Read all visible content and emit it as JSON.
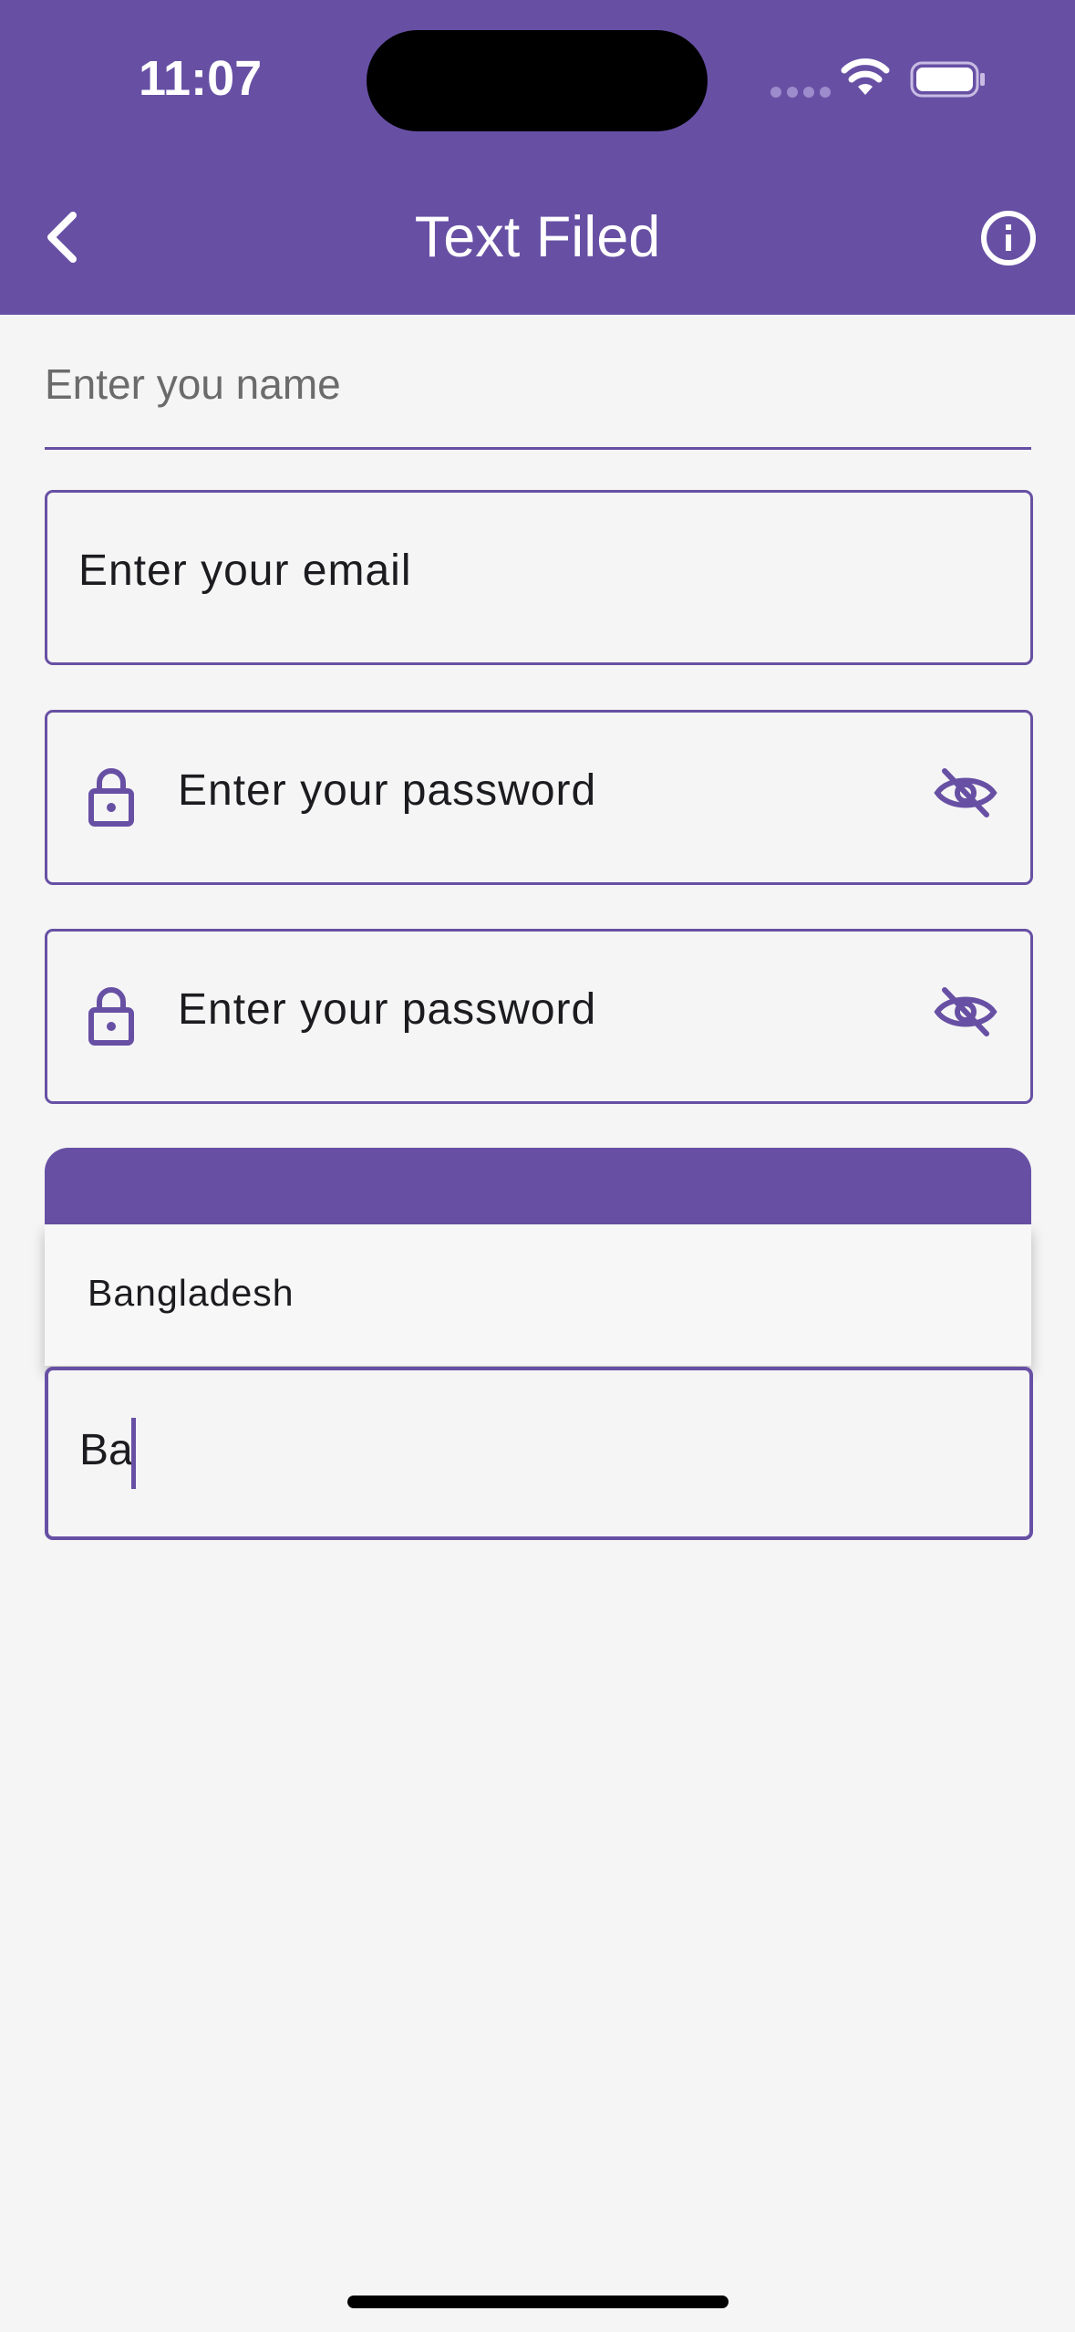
{
  "status_bar": {
    "time": "11:07"
  },
  "app_bar": {
    "title": "Text Filed",
    "back_icon": "chevron-left-icon",
    "info_icon": "info-circle-icon",
    "background_color": "#6750a4"
  },
  "form": {
    "name_field": {
      "placeholder": "Enter you name"
    },
    "email_field": {
      "placeholder": "Enter your email"
    },
    "password_field_1": {
      "placeholder": "Enter your password",
      "leading_icon": "lock-icon",
      "trailing_icon": "eye-off-icon"
    },
    "password_field_2": {
      "placeholder": "Enter your password",
      "leading_icon": "lock-icon",
      "trailing_icon": "eye-off-icon"
    },
    "autocomplete_field": {
      "value": "Ba",
      "suggestions": [
        "Bangladesh"
      ]
    }
  },
  "colors": {
    "accent": "#6750a4",
    "background": "#f5f5f5"
  }
}
